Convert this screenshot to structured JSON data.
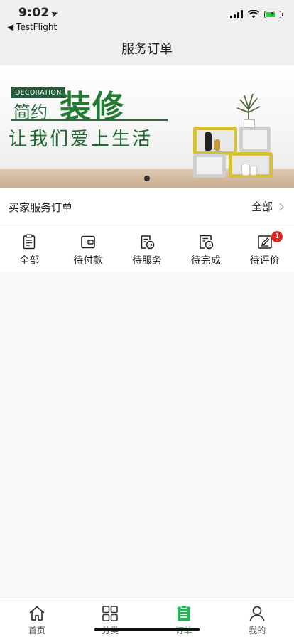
{
  "status_bar": {
    "time": "9:02",
    "back_app": "◀ TestFlight",
    "battery_level": 0.58
  },
  "nav": {
    "title": "服务订单"
  },
  "banner": {
    "tag": "DECORATION",
    "title_small": "简约",
    "title_big": "装修",
    "slogan": "让我们爱上生活",
    "page_count": 1,
    "current_page": 1
  },
  "section": {
    "title": "买家服务订单",
    "all_label": "全部"
  },
  "order_tabs": [
    {
      "label": "全部",
      "icon": "clipboard-icon"
    },
    {
      "label": "待付款",
      "icon": "wallet-icon"
    },
    {
      "label": "待服务",
      "icon": "service-icon"
    },
    {
      "label": "待完成",
      "icon": "clock-doc-icon"
    },
    {
      "label": "待评价",
      "icon": "edit-review-icon",
      "badge": "1"
    }
  ],
  "tab_bar": [
    {
      "label": "首页",
      "icon": "home-icon"
    },
    {
      "label": "分类",
      "icon": "grid-icon"
    },
    {
      "label": "订单",
      "icon": "order-icon",
      "active": true
    },
    {
      "label": "我的",
      "icon": "user-icon"
    }
  ],
  "colors": {
    "accent": "#27b35a",
    "badge": "#e5281f",
    "banner_green": "#237a33"
  }
}
